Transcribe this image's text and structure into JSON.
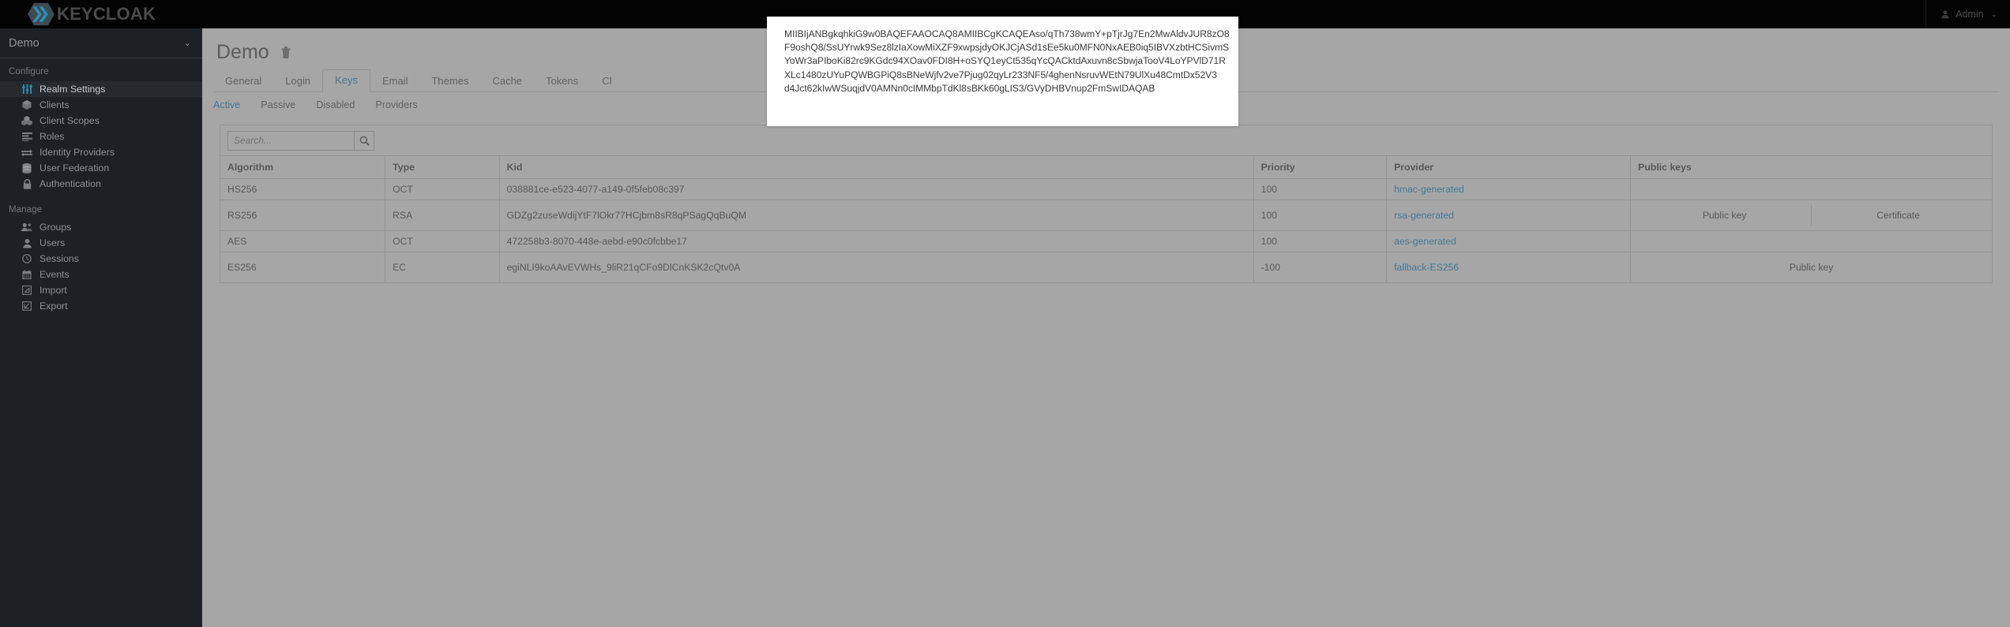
{
  "masthead": {
    "brand": "KEYCLOAK",
    "brand_icon": "keycloak-logo-icon",
    "user_icon": "user-icon",
    "user_label": "Admin",
    "user_caret": "⌄"
  },
  "sidebar": {
    "realm": {
      "name": "Demo",
      "caret": "⌄"
    },
    "groups": [
      {
        "title": "Configure",
        "items": [
          {
            "label": "Realm Settings",
            "icon": "sliders-icon",
            "active": true
          },
          {
            "label": "Clients",
            "icon": "cube-icon",
            "active": false
          },
          {
            "label": "Client Scopes",
            "icon": "cubes-icon",
            "active": false
          },
          {
            "label": "Roles",
            "icon": "list-icon",
            "active": false
          },
          {
            "label": "Identity Providers",
            "icon": "exchange-arrows-icon",
            "active": false
          },
          {
            "label": "User Federation",
            "icon": "database-icon",
            "active": false
          },
          {
            "label": "Authentication",
            "icon": "lock-icon",
            "active": false
          }
        ]
      },
      {
        "title": "Manage",
        "items": [
          {
            "label": "Groups",
            "icon": "users-group-icon",
            "active": false
          },
          {
            "label": "Users",
            "icon": "user-icon",
            "active": false
          },
          {
            "label": "Sessions",
            "icon": "clock-icon",
            "active": false
          },
          {
            "label": "Events",
            "icon": "calendar-icon",
            "active": false
          },
          {
            "label": "Import",
            "icon": "import-arrow-icon",
            "active": false
          },
          {
            "label": "Export",
            "icon": "export-arrow-icon",
            "active": false
          }
        ]
      }
    ]
  },
  "main": {
    "page_title": "Demo",
    "delete_icon": "trash-icon",
    "tabs": [
      {
        "label": "General",
        "active": false
      },
      {
        "label": "Login",
        "active": false
      },
      {
        "label": "Keys",
        "active": true
      },
      {
        "label": "Email",
        "active": false
      },
      {
        "label": "Themes",
        "active": false
      },
      {
        "label": "Cache",
        "active": false
      },
      {
        "label": "Tokens",
        "active": false
      },
      {
        "label": "Cl",
        "active": false
      }
    ],
    "subtabs": [
      {
        "label": "Active",
        "active": true
      },
      {
        "label": "Passive",
        "active": false
      },
      {
        "label": "Disabled",
        "active": false
      },
      {
        "label": "Providers",
        "active": false
      }
    ],
    "search": {
      "placeholder": "Search...",
      "value": "",
      "icon": "search-icon"
    },
    "table": {
      "columns": [
        "Algorithm",
        "Type",
        "Kid",
        "Priority",
        "Provider",
        "Public keys"
      ],
      "rows": [
        {
          "algorithm": "HS256",
          "type": "OCT",
          "kid": "038881ce-e523-4077-a149-0f5feb08c397",
          "priority": "100",
          "provider": "hmac-generated",
          "public_keys": []
        },
        {
          "algorithm": "RS256",
          "type": "RSA",
          "kid": "GDZg2zuseWdijYtF7lOkr77HCjbm8sR8qPSagQqBuQM",
          "priority": "100",
          "provider": "rsa-generated",
          "public_keys": [
            "Public key",
            "Certificate"
          ]
        },
        {
          "algorithm": "AES",
          "type": "OCT",
          "kid": "472258b3-8070-448e-aebd-e90c0fcbbe17",
          "priority": "100",
          "provider": "aes-generated",
          "public_keys": []
        },
        {
          "algorithm": "ES256",
          "type": "EC",
          "kid": "egiNLI9koAAvEVWHs_9liR21qCFo9DlCnKSK2cQtv0A",
          "priority": "-100",
          "provider": "fallback-ES256",
          "public_keys": [
            "Public key"
          ]
        }
      ]
    }
  },
  "popover": {
    "lines": [
      "MIIBIjANBgkqhkiG9w0BAQEFAAOCAQ8AMIIBCgKCAQEAso/qTh738wmY+pTjrJg7En2MwAldvJUR8zO8",
      "F9oshQ8/SsUYrwk9Sez8lzIaXowMiXZF9xwpsjdyOKJCjASd1sEe5ku0MFN0NxAEB0iq5IBVXzbtHCSivmS",
      "YoWr3aPIboKi82rc9KGdc94XOav0FDI8H+oSYQ1eyCt535qYcQACktdAxuvn8cSbwjaTooV4LoYPVlD71R",
      "XLc1480zUYuPQWBGPiQ8sBNeWjfv2ve7Pjug02qyLr233NF5/4ghenNsruvWEtN79UlXu48CmtDx52V3",
      "d4Jct62kIwWSuqjdV0AMNn0cIMMbpTdKl8sBKk60gLIS3/GVyDHBVnup2FmSwIDAQAB"
    ]
  },
  "colors": {
    "accent": "#0088ce",
    "masthead_bg": "#030303",
    "sidebar_bg": "#1d2024",
    "sidebar_active_bg": "#26292d",
    "backdrop": "rgba(112,112,112,0.62)"
  }
}
